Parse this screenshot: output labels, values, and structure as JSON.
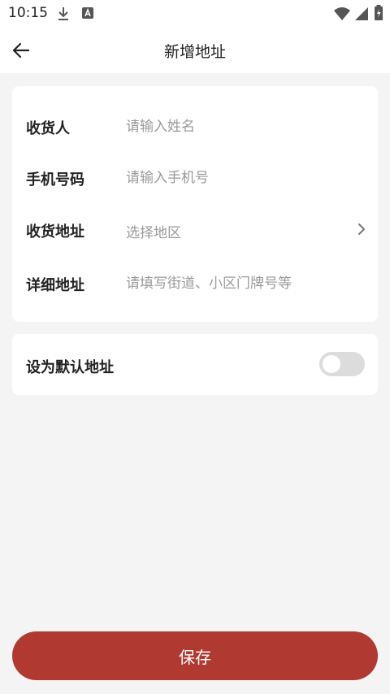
{
  "status_bar": {
    "time": "10:15",
    "icons": [
      "download-icon",
      "font-a-icon",
      "wifi-icon",
      "signal-icon",
      "battery-icon"
    ]
  },
  "app_bar": {
    "back_icon": "arrow-left-icon",
    "title": "新增地址"
  },
  "form": {
    "recipient": {
      "label": "收货人",
      "placeholder": "请输入姓名",
      "value": ""
    },
    "phone": {
      "label": "手机号码",
      "placeholder": "请输入手机号",
      "value": ""
    },
    "region": {
      "label": "收货地址",
      "placeholder": "选择地区",
      "icon": "chevron-right-icon"
    },
    "detail": {
      "label": "详细地址",
      "placeholder": "请填写街道、小区门牌号等",
      "value": ""
    }
  },
  "default_address": {
    "label": "设为默认地址",
    "enabled": false
  },
  "save_button": {
    "label": "保存"
  },
  "colors": {
    "accent": "#b03a32",
    "background": "#f4f4f4",
    "card": "#ffffff",
    "placeholder": "#9a9a9a",
    "toggle_off": "#dcdcdc"
  }
}
